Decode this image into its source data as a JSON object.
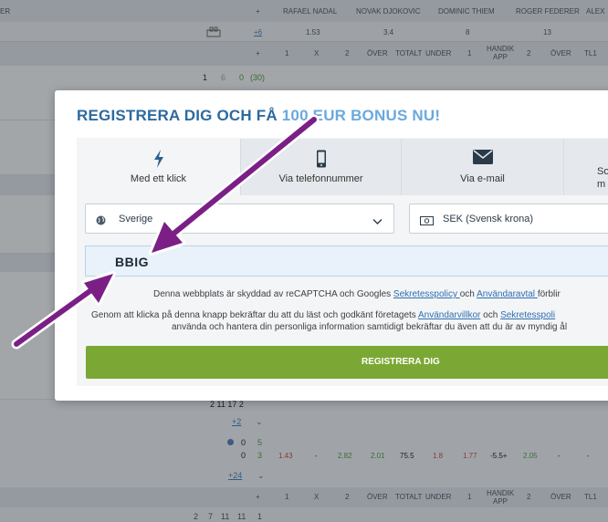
{
  "background": {
    "header": {
      "left_label": "er",
      "plus": "+",
      "players": [
        "RAFAEL NADAL",
        "NOVAK DJOKOVIC",
        "DOMINIC THIEM",
        "ROGER FEDERER",
        "ALEX"
      ]
    },
    "odds_row": {
      "more": "+6",
      "values": [
        "1.53",
        "3.4",
        "8",
        "13"
      ]
    },
    "columns_header": {
      "plus": "+",
      "cols": [
        "1",
        "X",
        "2",
        "ÖVER",
        "TOTALT",
        "UNDER",
        "1",
        "HANDIK APP",
        "2",
        "ÖVER",
        "TL1"
      ]
    },
    "score_top": {
      "a": "1",
      "b": "6",
      "c": "0",
      "d": "(30)"
    },
    "score_mid": "2 11 17 2",
    "match_more": "+2",
    "match2": {
      "s1": "0",
      "s2": "5",
      "s3": "0",
      "s4": "3",
      "more": "+24"
    },
    "match2_odds": [
      "1.43",
      "-",
      "2.82",
      "2.01",
      "75.5",
      "1.8",
      "1.77",
      "-5.5+",
      "2.05",
      "-",
      "-"
    ],
    "columns_header_bottom": {
      "plus": "+",
      "cols": [
        "1",
        "X",
        "2",
        "ÖVER",
        "TOTALT",
        "UNDER",
        "1",
        "HANDIK APP",
        "2",
        "ÖVER",
        "TL1"
      ]
    },
    "last_row": [
      "2",
      "7",
      "11",
      "11",
      "1"
    ]
  },
  "modal": {
    "title_main": "REGISTRERA DIG OCH FÅ ",
    "title_accent": "100 EUR BONUS NU!",
    "tabs": [
      {
        "label": "Med ett klick",
        "icon": "lightning-icon"
      },
      {
        "label": "Via telefonnummer",
        "icon": "phone-icon"
      },
      {
        "label": "Via e-mail",
        "icon": "envelope-icon"
      },
      {
        "label_line1": "So",
        "label_line2": "m"
      }
    ],
    "country": "Sverige",
    "currency": "SEK (Svensk krona)",
    "promo_code": "BBIG",
    "recaptcha_note": {
      "text1": "Denna webbplats är skyddad av reCAPTCHA och Googles ",
      "link1": "Sekretesspolicy ",
      "text2": "och ",
      "link2": "Användaravtal ",
      "text3": "förblir"
    },
    "consent_note": {
      "text1": "Genom att klicka på denna knapp bekräftar du att du läst och godkänt företagets ",
      "link1": "Användarvillkor",
      "text2": " och ",
      "link2": "Sekretesspoli",
      "line2": "använda och hantera din personliga information samtidigt bekräftar du även att du är av myndig ål"
    },
    "submit_label": "REGISTRERA DIG"
  },
  "colors": {
    "brand": "#2d6a9f",
    "accent": "#6aa9dd",
    "cta": "#7ba834",
    "annotation_arrow": "#7b1f86"
  }
}
